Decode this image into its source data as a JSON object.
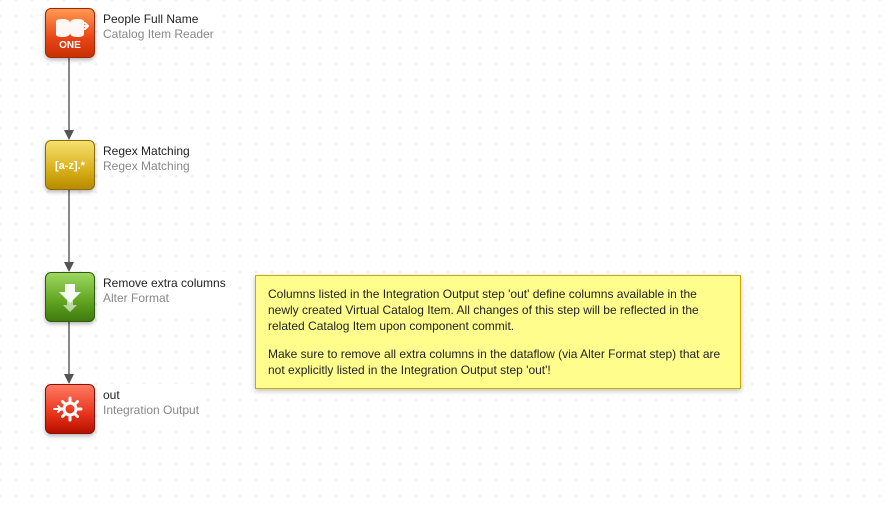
{
  "nodes": {
    "n1": {
      "title": "People Full Name",
      "subtitle": "Catalog Item Reader",
      "icon": "catalog-reader-icon"
    },
    "n2": {
      "title": "Regex Matching",
      "subtitle": "Regex Matching",
      "icon": "regex-icon"
    },
    "n3": {
      "title": "Remove extra columns",
      "subtitle": "Alter Format",
      "icon": "alter-format-icon"
    },
    "n4": {
      "title": "out",
      "subtitle": "Integration Output",
      "icon": "integration-output-icon"
    }
  },
  "note": {
    "para1": "Columns listed in the Integration Output step 'out' define columns available in the newly created Virtual Catalog Item. All changes of this step will be reflected in the related Catalog Item upon component commit.",
    "para2": "Make sure to remove all extra columns in the dataflow (via Alter Format step) that are not explicitly listed in the Integration Output step 'out'!"
  }
}
